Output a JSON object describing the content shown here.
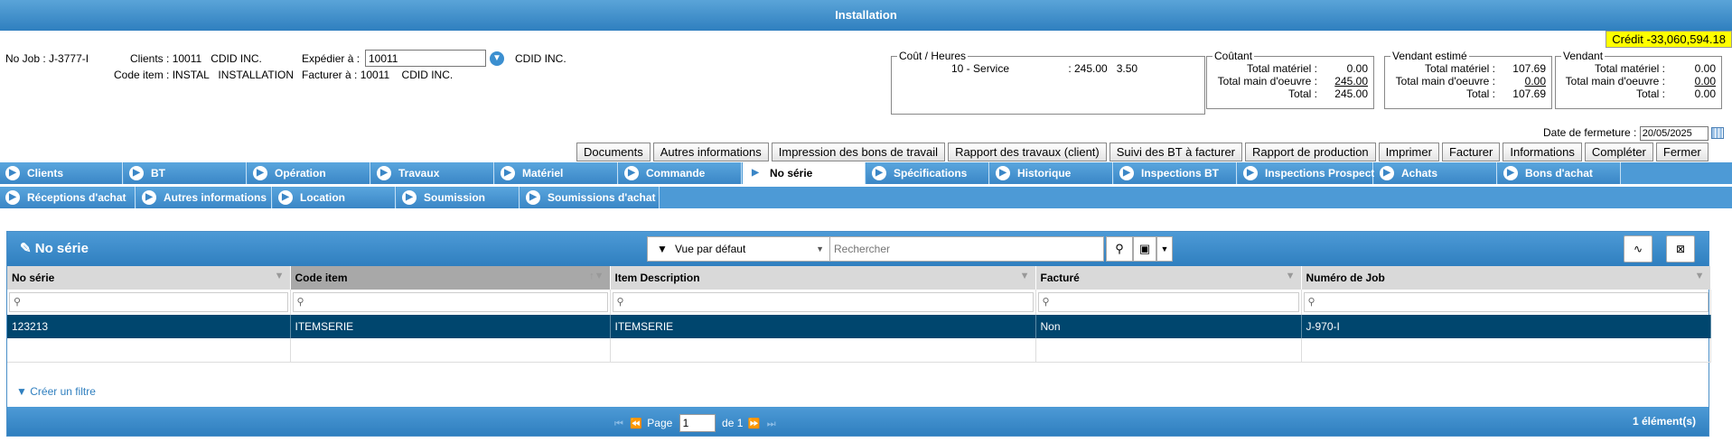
{
  "window": {
    "title": "Installation"
  },
  "credit": "Crédit -33,060,594.18",
  "header": {
    "job_label": "No Job :",
    "job_value": "J-3777-I",
    "clients_label": "Clients :",
    "clients_code": "10011",
    "clients_name": "CDID INC.",
    "code_item_label": "Code item :",
    "code_item_value": "INSTAL",
    "code_item_desc": "INSTALLATION",
    "ship_label": "Expédier à :",
    "ship_value": "10011",
    "ship_name": "CDID INC.",
    "bill_label": "Facturer à :",
    "bill_code": "10011",
    "bill_name": "CDID INC."
  },
  "cost_hours": {
    "legend": "Coût / Heures",
    "line_name": "10 - Service",
    "line_amount": ": 245.00",
    "line_hours": "3.50"
  },
  "coutant": {
    "legend": "Coûtant",
    "rows": [
      {
        "label": "Total matériel :",
        "value": "0.00"
      },
      {
        "label": "Total main d'oeuvre :",
        "value": "245.00"
      },
      {
        "label": "Total :",
        "value": "245.00"
      }
    ]
  },
  "vendant_estime": {
    "legend": "Vendant estimé",
    "rows": [
      {
        "label": "Total matériel :",
        "value": "107.69"
      },
      {
        "label": "Total main d'oeuvre :",
        "value": "0.00"
      },
      {
        "label": "Total :",
        "value": "107.69"
      }
    ]
  },
  "vendant": {
    "legend": "Vendant",
    "rows": [
      {
        "label": "Total matériel :",
        "value": "0.00"
      },
      {
        "label": "Total main d'oeuvre :",
        "value": "0.00"
      },
      {
        "label": "Total :",
        "value": "0.00"
      }
    ]
  },
  "closing": {
    "label": "Date de fermeture :",
    "value": "20/05/2025"
  },
  "actions": [
    "Documents",
    "Autres informations",
    "Impression des bons de travail",
    "Rapport des travaux (client)",
    "Suivi des BT à facturer",
    "Rapport de production",
    "Imprimer",
    "Facturer",
    "Informations",
    "Compléter",
    "Fermer"
  ],
  "tabs_row1": [
    "Clients",
    "BT",
    "Opération",
    "Travaux",
    "Matériel",
    "Commande",
    "No série",
    "Spécifications",
    "Historique",
    "Inspections BT",
    "Inspections Prospect",
    "Achats",
    "Bons d'achat"
  ],
  "tabs_row2": [
    "Réceptions d'achat",
    "Autres informations",
    "Location",
    "Soumission",
    "Soumissions d'achat"
  ],
  "active_tab": "No série",
  "panel": {
    "title": "No série",
    "view": "Vue par défaut",
    "search_placeholder": "Rechercher",
    "columns": [
      "No série",
      "Code item",
      "Item Description",
      "Facturé",
      "Numéro de Job"
    ],
    "rows": [
      [
        "123213",
        "ITEMSERIE",
        "ITEMSERIE",
        "Non",
        "J-970-I"
      ]
    ],
    "create_filter": "Créer un filtre",
    "page_label": "Page",
    "page_value": "1",
    "page_of": "de 1",
    "count": "1 élément(s)"
  }
}
